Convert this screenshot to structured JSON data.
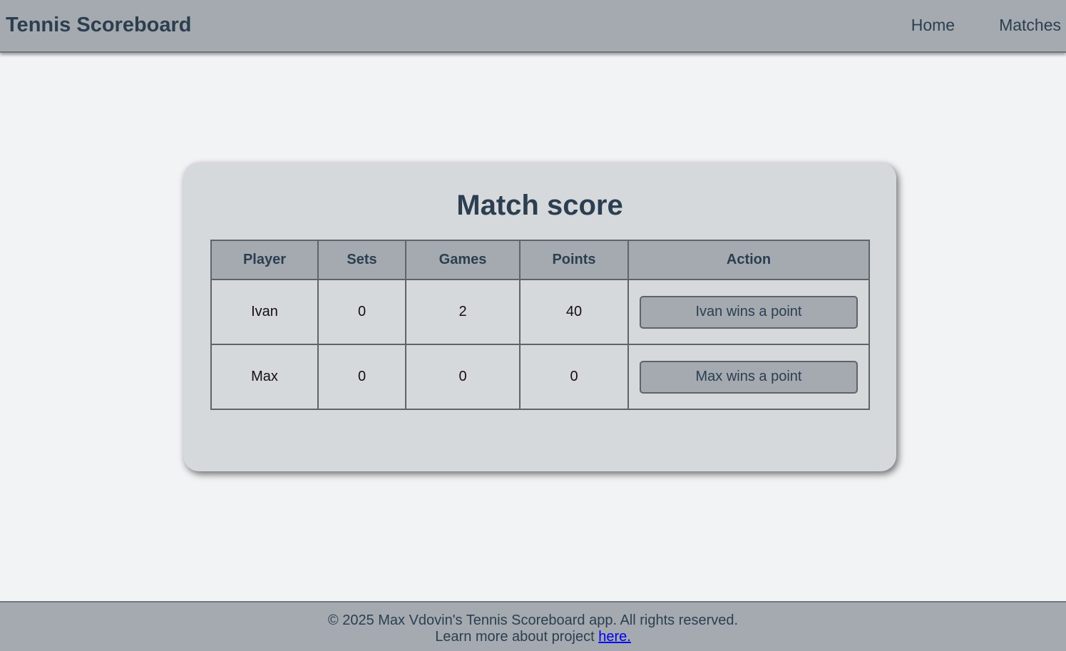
{
  "header": {
    "brand": "Tennis Scoreboard",
    "nav": [
      {
        "label": "Home"
      },
      {
        "label": "Matches"
      }
    ]
  },
  "main": {
    "title": "Match score",
    "table": {
      "headers": [
        "Player",
        "Sets",
        "Games",
        "Points",
        "Action"
      ],
      "rows": [
        {
          "player": "Ivan",
          "sets": "0",
          "games": "2",
          "points": "40",
          "action": "Ivan wins a point"
        },
        {
          "player": "Max",
          "sets": "0",
          "games": "0",
          "points": "0",
          "action": "Max wins a point"
        }
      ]
    }
  },
  "footer": {
    "copyright": "© 2025 Max Vdovin's Tennis Scoreboard app. All rights reserved.",
    "learn_more": "Learn more about project ",
    "link_label": "here."
  },
  "colors": {
    "header_bg": "#a4aaaf",
    "page_bg": "#f2f3f5",
    "card_bg": "#d6d9dc",
    "text_primary": "#2c3e50",
    "link": "#0000ee"
  }
}
